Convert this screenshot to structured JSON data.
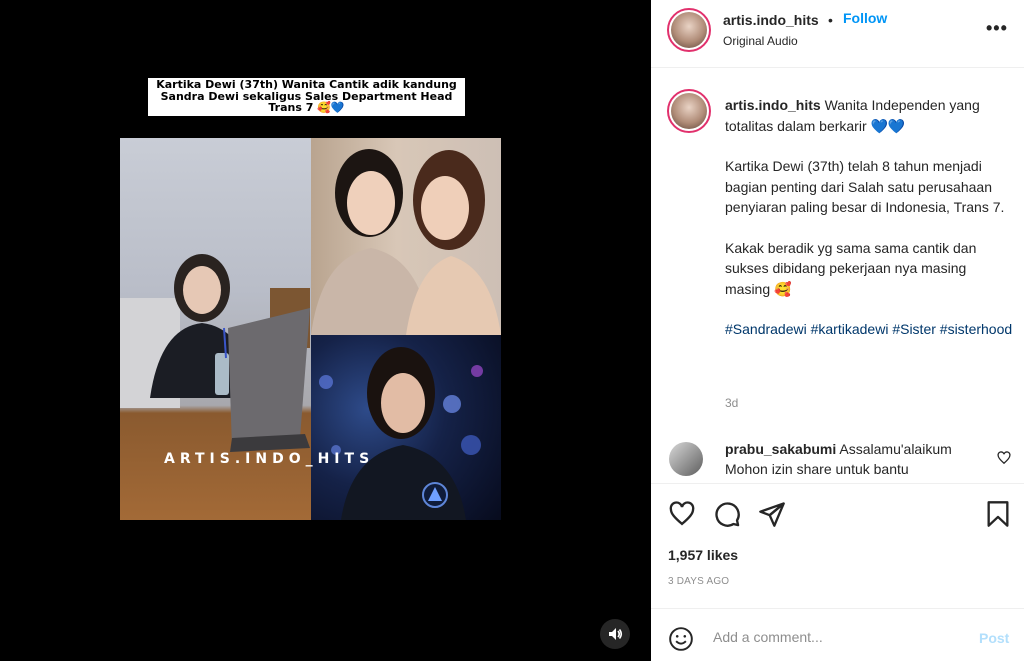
{
  "post": {
    "overlay_caption": "Kartika Dewi (37th) Wanita Cantik adik kandung Sandra Dewi sekaligus Sales Department Head Trans 7 🥰💙",
    "watermark": "ARTIS.INDO_HITS"
  },
  "header": {
    "username": "artis.indo_hits",
    "separator": "•",
    "follow_label": "Follow",
    "audio_label": "Original Audio",
    "more_label": "•••",
    "more_icon": "more-horizontal-icon",
    "avatar_icon": "avatar"
  },
  "caption": {
    "username": "artis.indo_hits",
    "line1": "Wanita Independen yang totalitas dalam berkarir 💙💙",
    "para2": "Kartika Dewi (37th) telah 8 tahun menjadi bagian penting dari Salah satu perusahaan penyiaran paling besar di Indonesia, Trans 7.",
    "para3": "Kakak beradik yg sama sama cantik dan sukses dibidang pekerjaan nya masing masing 🥰",
    "hashtags": "#Sandradewi #kartikadewi #Sister #sisterhood",
    "time": "3d"
  },
  "comment": {
    "username": "prabu_sakabumi",
    "text": "Assalamu'alaikum Mohon izin share untuk bantu"
  },
  "actions": {
    "icons": [
      "heart-icon",
      "comment-icon",
      "share-icon",
      "bookmark-icon"
    ],
    "likes": "1,957 likes",
    "posted": "3 DAYS AGO"
  },
  "add_comment": {
    "placeholder": "Add a comment...",
    "post_label": "Post",
    "post_color": "#b2dffc"
  },
  "colors": {
    "accent": "#0095f6",
    "hashtag": "#00376b",
    "muted": "#8e8e8e"
  }
}
